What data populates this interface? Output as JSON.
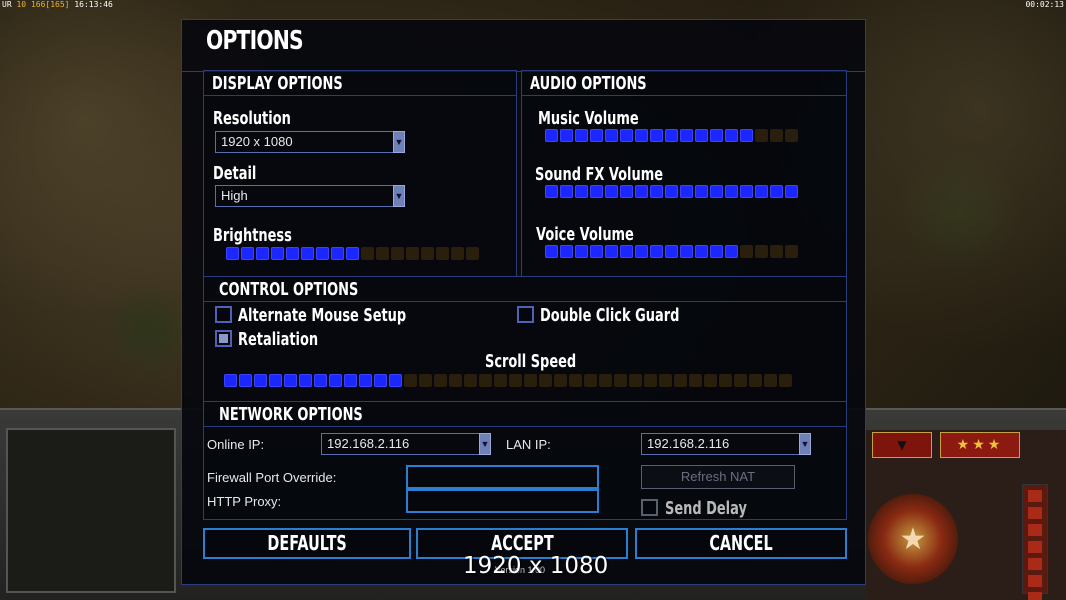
{
  "status_bar": {
    "left_prefix": "UR",
    "left_a": "10",
    "left_b": "166",
    "left_c": "[165]",
    "left_time": "16:13:46",
    "right_time": "00:02:13"
  },
  "dialog": {
    "title": "OPTIONS",
    "display": {
      "header": "DISPLAY OPTIONS",
      "resolution_label": "Resolution",
      "resolution_value": "1920 x 1080",
      "detail_label": "Detail",
      "detail_value": "High",
      "brightness_label": "Brightness",
      "brightness_level": 0.53
    },
    "audio": {
      "header": "AUDIO OPTIONS",
      "music_label": "Music Volume",
      "music_level": 0.85,
      "sfx_label": "Sound FX Volume",
      "sfx_level": 1.0,
      "voice_label": "Voice Volume",
      "voice_level": 0.75
    },
    "control": {
      "header": "CONTROL OPTIONS",
      "alt_mouse_label": "Alternate Mouse Setup",
      "alt_mouse_checked": false,
      "double_click_label": "Double Click Guard",
      "double_click_checked": false,
      "retaliation_label": "Retaliation",
      "retaliation_checked": true,
      "scroll_label": "Scroll Speed",
      "scroll_level": 0.32
    },
    "network": {
      "header": "NETWORK OPTIONS",
      "online_ip_label": "Online IP:",
      "online_ip_value": "192.168.2.116",
      "lan_ip_label": "LAN IP:",
      "lan_ip_value": "192.168.2.116",
      "firewall_label": "Firewall Port Override:",
      "firewall_value": "",
      "proxy_label": "HTTP Proxy:",
      "proxy_value": "",
      "refresh_nat_label": "Refresh NAT",
      "send_delay_label": "Send Delay",
      "send_delay_checked": false
    },
    "buttons": {
      "defaults": "DEFAULTS",
      "accept": "ACCEPT",
      "cancel": "CANCEL"
    },
    "version": "Version 1.00"
  },
  "overlay_resolution": "1920 x 1080",
  "hud": {
    "stars": "★★★",
    "emblem_glyph": "★"
  },
  "colors": {
    "slider_on": "#1c26ff",
    "slider_off": "#2a1e0c",
    "border_blue": "#2c7fd0",
    "panel_border": "#2a3d7a"
  }
}
